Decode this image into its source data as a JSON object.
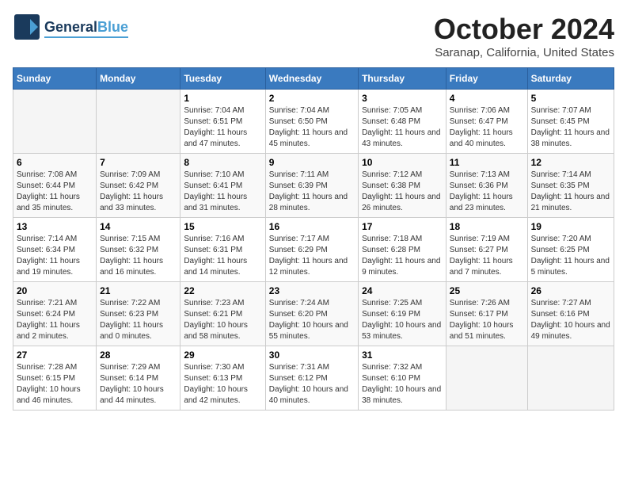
{
  "header": {
    "logo_line1": "General",
    "logo_line2": "Blue",
    "month_title": "October 2024",
    "location": "Saranap, California, United States"
  },
  "weekdays": [
    "Sunday",
    "Monday",
    "Tuesday",
    "Wednesday",
    "Thursday",
    "Friday",
    "Saturday"
  ],
  "weeks": [
    [
      {
        "day": "",
        "sunrise": "",
        "sunset": "",
        "daylight": ""
      },
      {
        "day": "",
        "sunrise": "",
        "sunset": "",
        "daylight": ""
      },
      {
        "day": "1",
        "sunrise": "Sunrise: 7:04 AM",
        "sunset": "Sunset: 6:51 PM",
        "daylight": "Daylight: 11 hours and 47 minutes."
      },
      {
        "day": "2",
        "sunrise": "Sunrise: 7:04 AM",
        "sunset": "Sunset: 6:50 PM",
        "daylight": "Daylight: 11 hours and 45 minutes."
      },
      {
        "day": "3",
        "sunrise": "Sunrise: 7:05 AM",
        "sunset": "Sunset: 6:48 PM",
        "daylight": "Daylight: 11 hours and 43 minutes."
      },
      {
        "day": "4",
        "sunrise": "Sunrise: 7:06 AM",
        "sunset": "Sunset: 6:47 PM",
        "daylight": "Daylight: 11 hours and 40 minutes."
      },
      {
        "day": "5",
        "sunrise": "Sunrise: 7:07 AM",
        "sunset": "Sunset: 6:45 PM",
        "daylight": "Daylight: 11 hours and 38 minutes."
      }
    ],
    [
      {
        "day": "6",
        "sunrise": "Sunrise: 7:08 AM",
        "sunset": "Sunset: 6:44 PM",
        "daylight": "Daylight: 11 hours and 35 minutes."
      },
      {
        "day": "7",
        "sunrise": "Sunrise: 7:09 AM",
        "sunset": "Sunset: 6:42 PM",
        "daylight": "Daylight: 11 hours and 33 minutes."
      },
      {
        "day": "8",
        "sunrise": "Sunrise: 7:10 AM",
        "sunset": "Sunset: 6:41 PM",
        "daylight": "Daylight: 11 hours and 31 minutes."
      },
      {
        "day": "9",
        "sunrise": "Sunrise: 7:11 AM",
        "sunset": "Sunset: 6:39 PM",
        "daylight": "Daylight: 11 hours and 28 minutes."
      },
      {
        "day": "10",
        "sunrise": "Sunrise: 7:12 AM",
        "sunset": "Sunset: 6:38 PM",
        "daylight": "Daylight: 11 hours and 26 minutes."
      },
      {
        "day": "11",
        "sunrise": "Sunrise: 7:13 AM",
        "sunset": "Sunset: 6:36 PM",
        "daylight": "Daylight: 11 hours and 23 minutes."
      },
      {
        "day": "12",
        "sunrise": "Sunrise: 7:14 AM",
        "sunset": "Sunset: 6:35 PM",
        "daylight": "Daylight: 11 hours and 21 minutes."
      }
    ],
    [
      {
        "day": "13",
        "sunrise": "Sunrise: 7:14 AM",
        "sunset": "Sunset: 6:34 PM",
        "daylight": "Daylight: 11 hours and 19 minutes."
      },
      {
        "day": "14",
        "sunrise": "Sunrise: 7:15 AM",
        "sunset": "Sunset: 6:32 PM",
        "daylight": "Daylight: 11 hours and 16 minutes."
      },
      {
        "day": "15",
        "sunrise": "Sunrise: 7:16 AM",
        "sunset": "Sunset: 6:31 PM",
        "daylight": "Daylight: 11 hours and 14 minutes."
      },
      {
        "day": "16",
        "sunrise": "Sunrise: 7:17 AM",
        "sunset": "Sunset: 6:29 PM",
        "daylight": "Daylight: 11 hours and 12 minutes."
      },
      {
        "day": "17",
        "sunrise": "Sunrise: 7:18 AM",
        "sunset": "Sunset: 6:28 PM",
        "daylight": "Daylight: 11 hours and 9 minutes."
      },
      {
        "day": "18",
        "sunrise": "Sunrise: 7:19 AM",
        "sunset": "Sunset: 6:27 PM",
        "daylight": "Daylight: 11 hours and 7 minutes."
      },
      {
        "day": "19",
        "sunrise": "Sunrise: 7:20 AM",
        "sunset": "Sunset: 6:25 PM",
        "daylight": "Daylight: 11 hours and 5 minutes."
      }
    ],
    [
      {
        "day": "20",
        "sunrise": "Sunrise: 7:21 AM",
        "sunset": "Sunset: 6:24 PM",
        "daylight": "Daylight: 11 hours and 2 minutes."
      },
      {
        "day": "21",
        "sunrise": "Sunrise: 7:22 AM",
        "sunset": "Sunset: 6:23 PM",
        "daylight": "Daylight: 11 hours and 0 minutes."
      },
      {
        "day": "22",
        "sunrise": "Sunrise: 7:23 AM",
        "sunset": "Sunset: 6:21 PM",
        "daylight": "Daylight: 10 hours and 58 minutes."
      },
      {
        "day": "23",
        "sunrise": "Sunrise: 7:24 AM",
        "sunset": "Sunset: 6:20 PM",
        "daylight": "Daylight: 10 hours and 55 minutes."
      },
      {
        "day": "24",
        "sunrise": "Sunrise: 7:25 AM",
        "sunset": "Sunset: 6:19 PM",
        "daylight": "Daylight: 10 hours and 53 minutes."
      },
      {
        "day": "25",
        "sunrise": "Sunrise: 7:26 AM",
        "sunset": "Sunset: 6:17 PM",
        "daylight": "Daylight: 10 hours and 51 minutes."
      },
      {
        "day": "26",
        "sunrise": "Sunrise: 7:27 AM",
        "sunset": "Sunset: 6:16 PM",
        "daylight": "Daylight: 10 hours and 49 minutes."
      }
    ],
    [
      {
        "day": "27",
        "sunrise": "Sunrise: 7:28 AM",
        "sunset": "Sunset: 6:15 PM",
        "daylight": "Daylight: 10 hours and 46 minutes."
      },
      {
        "day": "28",
        "sunrise": "Sunrise: 7:29 AM",
        "sunset": "Sunset: 6:14 PM",
        "daylight": "Daylight: 10 hours and 44 minutes."
      },
      {
        "day": "29",
        "sunrise": "Sunrise: 7:30 AM",
        "sunset": "Sunset: 6:13 PM",
        "daylight": "Daylight: 10 hours and 42 minutes."
      },
      {
        "day": "30",
        "sunrise": "Sunrise: 7:31 AM",
        "sunset": "Sunset: 6:12 PM",
        "daylight": "Daylight: 10 hours and 40 minutes."
      },
      {
        "day": "31",
        "sunrise": "Sunrise: 7:32 AM",
        "sunset": "Sunset: 6:10 PM",
        "daylight": "Daylight: 10 hours and 38 minutes."
      },
      {
        "day": "",
        "sunrise": "",
        "sunset": "",
        "daylight": ""
      },
      {
        "day": "",
        "sunrise": "",
        "sunset": "",
        "daylight": ""
      }
    ]
  ]
}
